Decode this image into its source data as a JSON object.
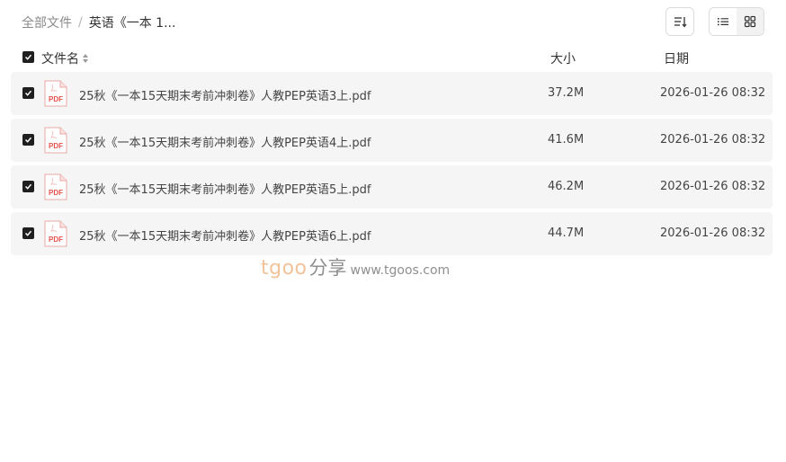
{
  "breadcrumb": {
    "root": "全部文件",
    "separator": "/",
    "current": "英语《一本 1..."
  },
  "toolbar": {
    "sort_icon": "sort-icon",
    "list_view_icon": "list-view-icon",
    "grid_view_icon": "grid-view-icon",
    "active_view": "list"
  },
  "columns": {
    "name": "文件名",
    "size": "大小",
    "date": "日期"
  },
  "files": [
    {
      "name": "25秋《一本15天期末考前冲刺卷》人教PEP英语3上.pdf",
      "size": "37.2M",
      "date": "2026-01-26 08:32",
      "checked": true,
      "icon": "pdf-icon"
    },
    {
      "name": "25秋《一本15天期末考前冲刺卷》人教PEP英语4上.pdf",
      "size": "41.6M",
      "date": "2026-01-26 08:32",
      "checked": true,
      "icon": "pdf-icon"
    },
    {
      "name": "25秋《一本15天期末考前冲刺卷》人教PEP英语5上.pdf",
      "size": "46.2M",
      "date": "2026-01-26 08:32",
      "checked": true,
      "icon": "pdf-icon"
    },
    {
      "name": "25秋《一本15天期末考前冲刺卷》人教PEP英语6上.pdf",
      "size": "44.7M",
      "date": "2026-01-26 08:32",
      "checked": true,
      "icon": "pdf-icon"
    }
  ],
  "pdf_badge_text": "PDF",
  "watermark": {
    "logo": "tgoo",
    "logo_cn": "分享",
    "url": "www.tgoos.com"
  },
  "colors": {
    "row_bg": "#f5f5f5",
    "checkbox": "#1f1f1f",
    "pdf_red": "#e5524c",
    "watermark_orange": "#f2c39a"
  }
}
